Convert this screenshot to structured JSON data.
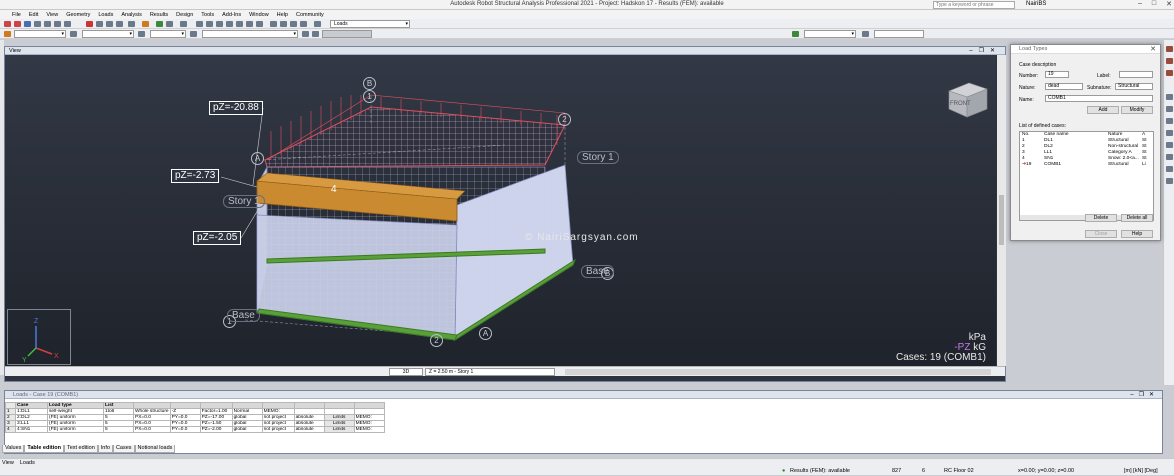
{
  "window": {
    "title": "Autodesk Robot Structural Analysis Professional 2021 - Project: Hadskon 17 - Results (FEM): available",
    "search_placeholder": "Type a keyword or phrase",
    "user": "NairiBS"
  },
  "menu": [
    "File",
    "Edit",
    "View",
    "Geometry",
    "Loads",
    "Analysis",
    "Results",
    "Design",
    "Tools",
    "Add-Ins",
    "Window",
    "Help",
    "Community"
  ],
  "toolbar": {
    "loads_combo": "Loads"
  },
  "view": {
    "title": "View",
    "labels": {
      "pz1": "pZ=-20.88",
      "pz2": "pZ=-2.73",
      "pz3": "pZ=-2.05",
      "beam_num": "4",
      "grid_b": "B",
      "grid_a1": "A",
      "grid_a2": "A",
      "grid_b2": "B",
      "num1": "1",
      "num2a": "2",
      "num2b": "2",
      "num1b": "1",
      "story1_right": "Story 1",
      "story1_left": "Story 1",
      "base_right": "Base",
      "base_left": "Base"
    },
    "watermark": "© NairiSargsyan.com",
    "cube_label": "FRONT",
    "legend": {
      "units1": "kPa",
      "units2_prefix": "-PZ",
      "units2": "kG",
      "cases": "Cases: 19 (COMB1)"
    },
    "footer": {
      "mode": "3D",
      "level": "Z = 2.50 m - Story 1"
    }
  },
  "load_types_dialog": {
    "title": "Load Types",
    "case_description": "Case description",
    "number_label": "Number:",
    "number_value": "19",
    "label_label": "Label:",
    "label_value": "",
    "nature_label": "Nature:",
    "nature_value": "dead",
    "subnature_label": "Subnature:",
    "subnature_value": "Structural",
    "name_label": "Name:",
    "name_value": "COMB1",
    "add_button": "Add",
    "modify_button": "Modify",
    "list_label": "List of defined cases:",
    "columns": [
      "No.",
      "Case name",
      "Nature",
      "A"
    ],
    "rows": [
      {
        "no": "1",
        "name": "DL1",
        "nature": "Structural",
        "a": "St"
      },
      {
        "no": "2",
        "name": "DL2",
        "nature": "Non-structural",
        "a": "St"
      },
      {
        "no": "3",
        "name": "LL1",
        "nature": "Category A",
        "a": "St"
      },
      {
        "no": "4",
        "name": "SN1",
        "nature": "Snow: 2.0<a...",
        "a": "St"
      },
      {
        "no": "19",
        "name": "COMB1",
        "nature": "Structural",
        "a": "Li"
      }
    ],
    "delete_button": "Delete",
    "delete_all_button": "Delete all",
    "close_button": "Close",
    "help_button": "Help"
  },
  "loads_table": {
    "title": "Loads - Case 19 (COMB1)",
    "columns": [
      "Case",
      "Load type",
      "List",
      "",
      "",
      "",
      "",
      "",
      "",
      "",
      ""
    ],
    "rows": [
      {
        "rn": "1",
        "case": "1:DL1",
        "type": "self-weight",
        "list": "1to6",
        "c1": "Whole structure",
        "c2": "-Z",
        "c3": "Factor=1.00",
        "c4": "Normal",
        "c5": "MEMO:",
        "c6": "",
        "c7": "",
        "c8": ""
      },
      {
        "rn": "2",
        "case": "2:DL2",
        "type": "(FE) uniform",
        "list": "5",
        "c1": "PX=0.0",
        "c2": "PY=0.0",
        "c3": "PZ=-17.00",
        "c4": "global",
        "c5": "not project",
        "c6": "absolute",
        "c7": "Limits",
        "c8": "MEMO:"
      },
      {
        "rn": "3",
        "case": "3:LL1",
        "type": "(FE) uniform",
        "list": "5",
        "c1": "PX=0.0",
        "c2": "PY=0.0",
        "c3": "PZ=-1.50",
        "c4": "global",
        "c5": "not project",
        "c6": "absolute",
        "c7": "Limits",
        "c8": "MEMO:"
      },
      {
        "rn": "4",
        "case": "4:SN1",
        "type": "(FE) uniform",
        "list": "5",
        "c1": "PX=0.0",
        "c2": "PY=0.0",
        "c3": "PZ=-2.00",
        "c4": "global",
        "c5": "not project",
        "c6": "absolute",
        "c7": "Limits",
        "c8": "MEMO:"
      }
    ],
    "tabs": [
      "Values",
      "Table edition",
      "Info",
      "Cases",
      "Notional loads"
    ]
  },
  "statusbar": {
    "tabs": [
      "View",
      "Loads"
    ],
    "results": "Results (FEM): available",
    "num1": "827",
    "num2": "6",
    "floor": "RC Floor 02",
    "coords": "x=0.00; y=0.00; z=0.00",
    "units": "[m] [kN] [Deg]"
  }
}
